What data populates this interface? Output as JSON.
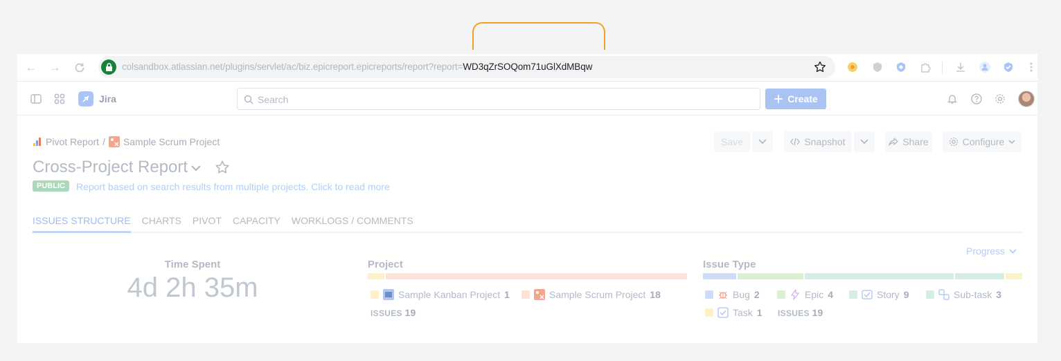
{
  "browser": {
    "url_prefix": "colsandbox.atlassian.net/plugins/servlet/ac/biz.epicreport.epicreports/report?report=",
    "url_highlight": "WD3qZrSOQom71uGlXdMBqw"
  },
  "nav": {
    "app_name": "Jira",
    "search_placeholder": "Search",
    "create_label": "Create"
  },
  "breadcrumbs": [
    "Pivot Report",
    "/",
    "Sample Scrum Project"
  ],
  "actions": {
    "save": "Save",
    "snapshot": "Snapshot",
    "share": "Share",
    "configure": "Configure"
  },
  "report": {
    "title": "Cross-Project Report",
    "badge": "PUBLIC",
    "description": "Report based on search results from multiple projects. Click to read more"
  },
  "tabs": [
    "ISSUES STRUCTURE",
    "CHARTS",
    "PIVOT",
    "CAPACITY",
    "WORKLOGS / COMMENTS"
  ],
  "progress_label": "Progress",
  "time_spent": {
    "label": "Time Spent",
    "value": "4d 2h 35m"
  },
  "project": {
    "title": "Project",
    "items": [
      {
        "name": "Sample Kanban Project",
        "count": "1",
        "share": 1,
        "color": "#fef0c7"
      },
      {
        "name": "Sample Scrum Project",
        "count": "18",
        "share": 18,
        "color": "#fde3d7"
      }
    ],
    "issues_label": "ISSUES",
    "issues_count": "19"
  },
  "issue_type": {
    "title": "Issue Type",
    "items": [
      {
        "name": "Bug",
        "count": "2",
        "share": 2,
        "color": "#cddcf8",
        "icon": "bug-icon"
      },
      {
        "name": "Epic",
        "count": "4",
        "share": 4,
        "color": "#dcefd3",
        "icon": "epic-icon"
      },
      {
        "name": "Story",
        "count": "9",
        "share": 9,
        "color": "#d5ede2",
        "icon": "story-icon"
      },
      {
        "name": "Sub-task",
        "count": "3",
        "share": 3,
        "color": "#d5ede2",
        "icon": "subtask-icon"
      },
      {
        "name": "Task",
        "count": "1",
        "share": 1,
        "color": "#fef0c7",
        "icon": "task-icon"
      }
    ],
    "issues_label": "ISSUES",
    "issues_count": "19"
  }
}
